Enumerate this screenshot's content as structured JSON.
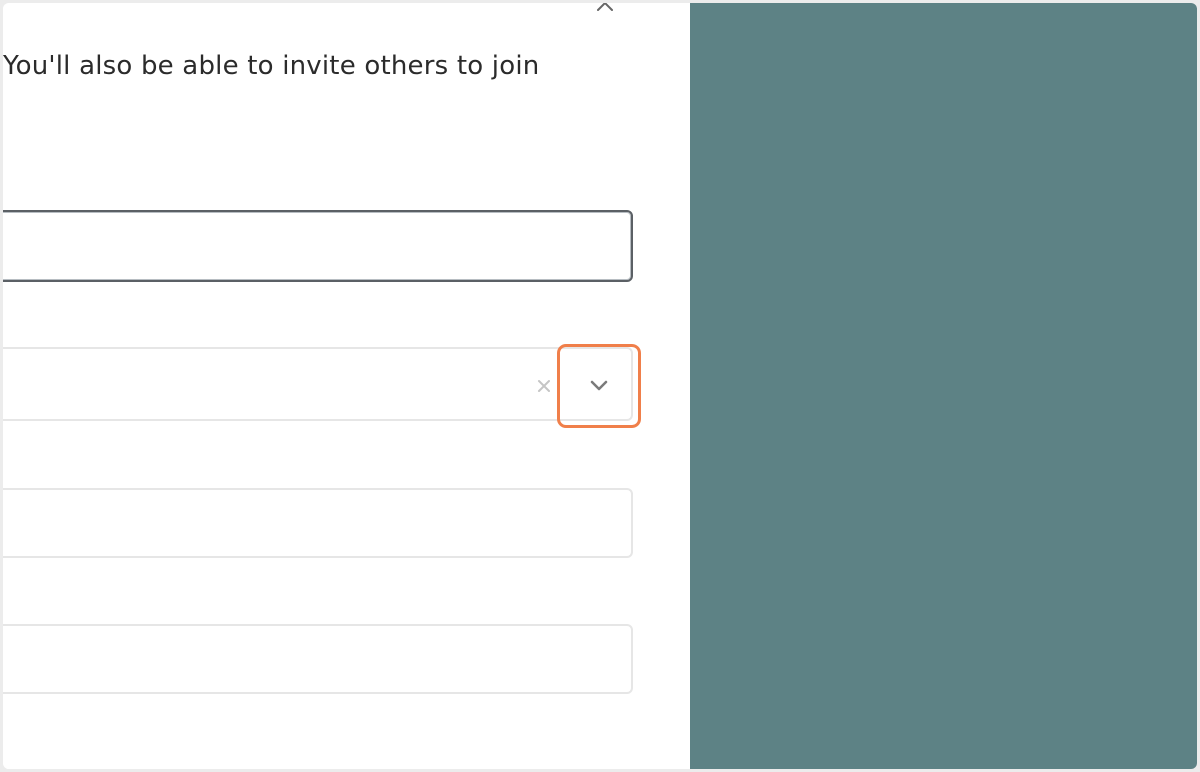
{
  "dialog": {
    "intro_text": "You'll also be able to invite others to join",
    "fields": [
      {
        "value": "",
        "placeholder": ""
      },
      {
        "value": "",
        "placeholder": ""
      },
      {
        "value": "",
        "placeholder": ""
      },
      {
        "value": "",
        "placeholder": ""
      }
    ],
    "icons": {
      "close": "close-icon",
      "clear": "clear-icon",
      "dropdown": "chevron-down-icon"
    }
  },
  "colors": {
    "side_panel": "#5d8285",
    "highlight": "#f07f4a",
    "focused_border": "#5b6065"
  }
}
